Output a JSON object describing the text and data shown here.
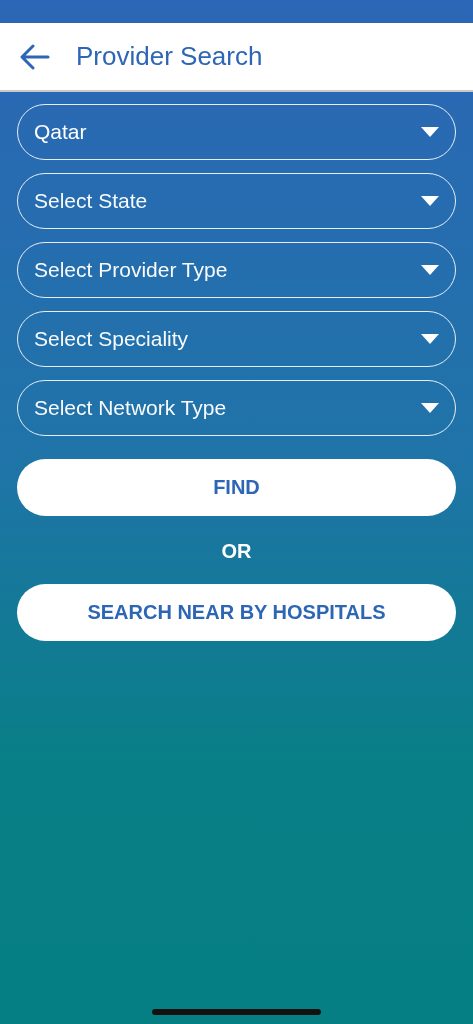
{
  "header": {
    "title": "Provider Search"
  },
  "dropdowns": [
    {
      "value": "Qatar"
    },
    {
      "placeholder": "Select State"
    },
    {
      "placeholder": "Select Provider Type"
    },
    {
      "placeholder": "Select Speciality"
    },
    {
      "placeholder": "Select Network Type"
    }
  ],
  "find_button": "FIND",
  "separator": "OR",
  "nearby_button": "SEARCH NEAR BY HOSPITALS"
}
